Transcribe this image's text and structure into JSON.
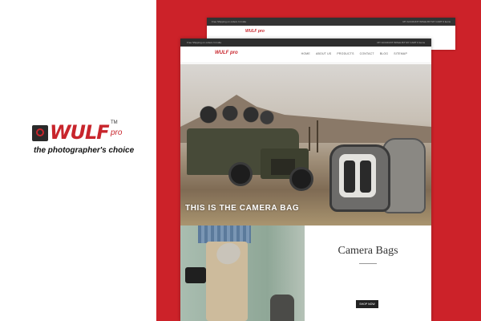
{
  "brand": {
    "wordmark": "WULF",
    "suffix": "pro",
    "trademark": "TM",
    "tagline": "the photographer's choice"
  },
  "back_window": {
    "topbar_left": "Free Shipping on orders In India",
    "topbar_right": "MY ACCOUNT   WISHLIST   MY CART  0 items"
  },
  "front_window": {
    "topbar_left": "Free Shipping on orders In India",
    "topbar_right": "MY ACCOUNT   WISHLIST   MY CART  0 items",
    "nav": {
      "logo": "WULF pro",
      "items": [
        "HOME",
        "ABOUT US",
        "PRODUCTS",
        "CONTACT",
        "BLOG",
        "SITEMAP"
      ]
    },
    "hero": {
      "caption": "THIS IS THE CAMERA BAG"
    },
    "promo": {
      "title": "Camera Bags",
      "body": "",
      "button": "SHOP NOW"
    }
  },
  "colors": {
    "accent": "#cc2229",
    "topbar": "#2e2e2e"
  }
}
